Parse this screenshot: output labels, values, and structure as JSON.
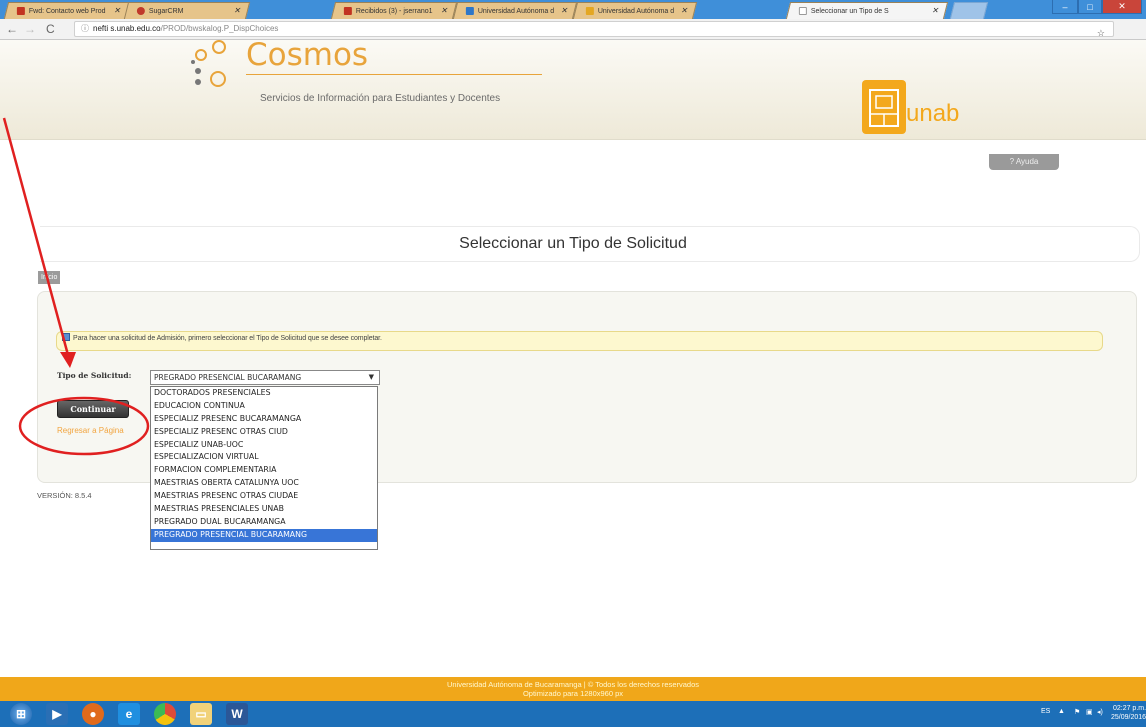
{
  "browser": {
    "tabs": [
      {
        "label": "Fwd: Contacto web Prod",
        "favicon": "gmail-icon",
        "color": "#c23321"
      },
      {
        "label": "SugarCRM",
        "favicon": "sugarcrm-icon",
        "color": "#c0392b"
      },
      {
        "label": "Recibidos (3) - jserrano1",
        "favicon": "gmail-icon",
        "color": "#c23321"
      },
      {
        "label": "Universidad Autónoma d",
        "favicon": "calendar-icon",
        "color": "#2e77c8"
      },
      {
        "label": "Universidad Autónoma d",
        "favicon": "calendar-icon",
        "color": "#e4a722"
      },
      {
        "label": "Seleccionar un Tipo de S",
        "favicon": "page-icon",
        "color": "#999999"
      }
    ],
    "url_host": "nefti s.unab.edu.co",
    "url_path": "/PROD/bwskalog.P_DispChoices"
  },
  "header": {
    "brand": "Cosmos",
    "tagline": "Servicios de Información para Estudiantes y Docentes",
    "unab": "unab"
  },
  "help_label": "? Ayuda",
  "page_title": "Seleccionar un Tipo de Solicitud",
  "inicio_label": "Inicio",
  "info_message": "Para hacer una solicitud de Admisión, primero seleccionar el Tipo de Solicitud que se desee completar.",
  "form": {
    "label": "Tipo de Solicitud:",
    "selected": "PREGRADO PRESENCIAL BUCARAMANG",
    "options": [
      "DOCTORADOS PRESENCIALES",
      "EDUCACION CONTINUA",
      "ESPECIALIZ PRESENC BUCARAMANGA",
      "ESPECIALIZ PRESENC OTRAS CIUD",
      "ESPECIALIZ UNAB-UOC",
      "ESPECIALIZACION VIRTUAL",
      "FORMACION COMPLEMENTARIA",
      "MAESTRIAS OBERTA CATALUNYA UOC",
      "MAESTRIAS PRESENC OTRAS CIUDAE",
      "MAESTRIAS PRESENCIALES UNAB",
      "PREGRADO DUAL BUCARAMANGA",
      "PREGRADO PRESENCIAL BUCARAMANG"
    ],
    "selected_index": 11,
    "continue": "Continuar",
    "back": "Regresar a Página"
  },
  "version": "VERSIÓN: 8.5.4",
  "footer": {
    "line1": "Universidad Autónoma de Bucaramanga | © Todos los derechos reservados",
    "line2": "Optimizado para 1280x960 px"
  },
  "taskbar": {
    "lang": "ES",
    "time": "02:27 p.m.",
    "date": "25/09/2016"
  },
  "colors": {
    "brand_orange": "#e8a43b",
    "footer": "#f0a71a",
    "annotation_red": "#e02020"
  }
}
